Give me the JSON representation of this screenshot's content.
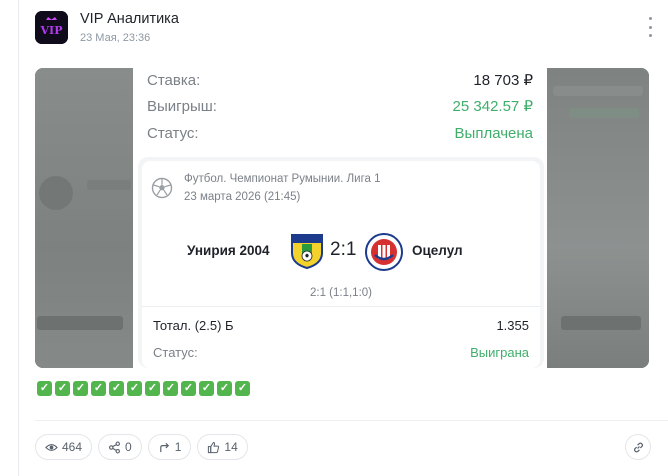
{
  "post": {
    "channel_name": "VIP Аналитика",
    "date": "23 Мая, 23:36",
    "avatar_text": "VIP"
  },
  "bet": {
    "stake_label": "Ставка:",
    "stake_value": "18 703 ₽",
    "win_label": "Выигрыш:",
    "win_value": "25 342.57 ₽",
    "status_label": "Статус:",
    "status_value": "Выплачена"
  },
  "event": {
    "league": "Футбол. Чемпионат Румынии. Лига 1",
    "date": "23 марта 2026 (21:45)",
    "home_team": "Унирия 2004",
    "away_team": "Оцелул",
    "score": "2:1",
    "halves": "2:1 (1:1,1:0)",
    "market": "Тотал. (2.5) Б",
    "odds": "1.355",
    "status_label": "Статус:",
    "status_value": "Выиграна"
  },
  "checkmarks": [
    "✓",
    "✓",
    "✓",
    "✓",
    "✓",
    "✓",
    "✓",
    "✓",
    "✓",
    "✓",
    "✓",
    "✓"
  ],
  "footer": {
    "views": "464",
    "shares": "0",
    "reposts": "1",
    "likes": "14"
  },
  "colors": {
    "accent_green": "#3fae6b",
    "check_green": "#53b54d",
    "avatar_purple": "#9b3cf2"
  },
  "icons": [
    "more-vertical-icon",
    "soccer-ball-icon",
    "eye-icon",
    "share-icon",
    "repost-icon",
    "thumbs-up-icon",
    "link-icon",
    "checkbox-icon"
  ]
}
